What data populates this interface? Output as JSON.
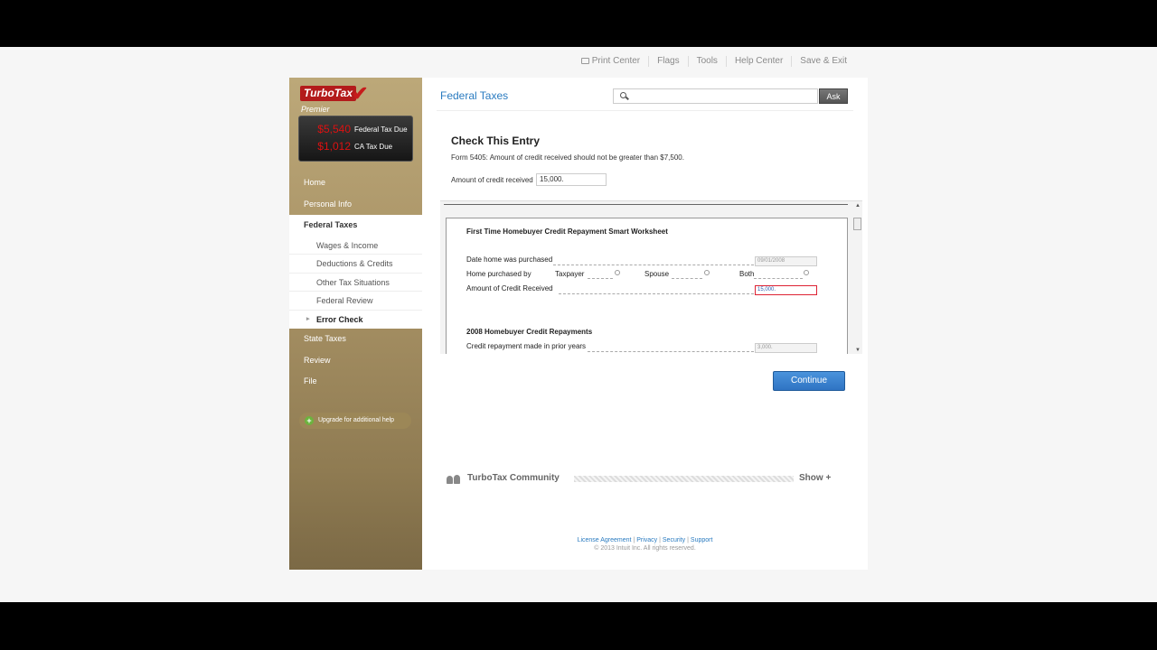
{
  "topnav": {
    "items": [
      "Print Center",
      "Flags",
      "Tools",
      "Help Center",
      "Save & Exit"
    ]
  },
  "sidebar": {
    "brand": "TurboTax",
    "edition": "Premier",
    "federal_amount": "$5,540",
    "federal_label": "Federal Tax Due",
    "state_amount": "$1,012",
    "state_label": "CA Tax Due",
    "nav": [
      "Home",
      "Personal Info",
      "Federal Taxes",
      "State Taxes",
      "Review",
      "File"
    ],
    "subnav": [
      "Wages & Income",
      "Deductions & Credits",
      "Other Tax Situations",
      "Federal Review",
      "Error Check"
    ],
    "upgrade": "Upgrade for additional help"
  },
  "header": {
    "title": "Federal Taxes",
    "search_value": "",
    "ask_label": "Ask"
  },
  "check": {
    "title": "Check This Entry",
    "message": "Form 5405: Amount of credit received should not be greater than $7,500.",
    "field_label": "Amount of credit received",
    "field_value": "15,000."
  },
  "worksheet": {
    "title": "First Time Homebuyer Credit Repayment Smart Worksheet",
    "date_label": "Date home was purchased",
    "date_value": "09/01/2008",
    "purchased_by_label": "Home purchased by",
    "options": [
      "Taxpayer",
      "Spouse",
      "Both"
    ],
    "credit_label": "Amount of Credit Received",
    "credit_value": "15,000.",
    "section2": "2008 Homebuyer Credit Repayments",
    "prior_label": "Credit repayment made in prior years",
    "prior_value": "3,000."
  },
  "continue_label": "Continue",
  "community": {
    "label": "TurboTax Community",
    "show": "Show +"
  },
  "footer": {
    "links": [
      "License Agreement",
      "Privacy",
      "Security",
      "Support"
    ],
    "copyright": "© 2013 Intuit Inc. All rights reserved."
  }
}
